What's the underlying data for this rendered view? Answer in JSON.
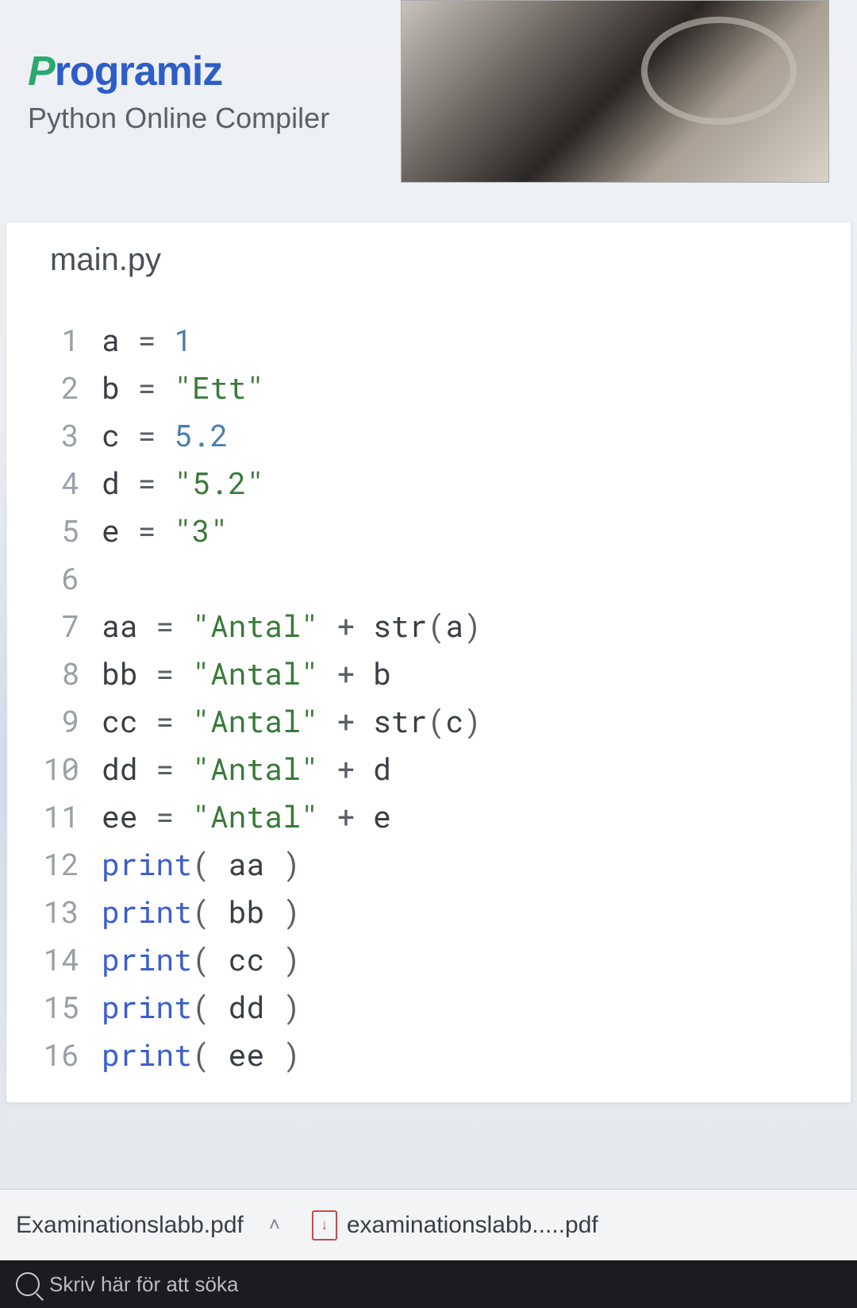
{
  "header": {
    "logo_first": "P",
    "logo_rest": "rogramiz",
    "subtitle": "Python Online Compiler"
  },
  "editor": {
    "tab_name": "main.py",
    "lines": [
      {
        "n": "1",
        "tokens": [
          [
            "var",
            "a"
          ],
          [
            "sp",
            " "
          ],
          [
            "op",
            "="
          ],
          [
            "sp",
            " "
          ],
          [
            "num",
            "1"
          ]
        ]
      },
      {
        "n": "2",
        "tokens": [
          [
            "var",
            "b"
          ],
          [
            "sp",
            " "
          ],
          [
            "op",
            "="
          ],
          [
            "sp",
            " "
          ],
          [
            "str",
            "\"Ett\""
          ]
        ]
      },
      {
        "n": "3",
        "tokens": [
          [
            "var",
            "c"
          ],
          [
            "sp",
            " "
          ],
          [
            "op",
            "="
          ],
          [
            "sp",
            " "
          ],
          [
            "num",
            "5.2"
          ]
        ]
      },
      {
        "n": "4",
        "tokens": [
          [
            "var",
            "d"
          ],
          [
            "sp",
            " "
          ],
          [
            "op",
            "="
          ],
          [
            "sp",
            " "
          ],
          [
            "str",
            "\"5.2\""
          ]
        ]
      },
      {
        "n": "5",
        "tokens": [
          [
            "var",
            "e"
          ],
          [
            "sp",
            " "
          ],
          [
            "op",
            "="
          ],
          [
            "sp",
            " "
          ],
          [
            "str",
            "\"3\""
          ]
        ]
      },
      {
        "n": "6",
        "tokens": []
      },
      {
        "n": "7",
        "tokens": [
          [
            "var",
            "aa"
          ],
          [
            "sp",
            " "
          ],
          [
            "op",
            "="
          ],
          [
            "sp",
            " "
          ],
          [
            "str",
            "\"Antal\""
          ],
          [
            "sp",
            " "
          ],
          [
            "op",
            "+"
          ],
          [
            "sp",
            " "
          ],
          [
            "fn",
            "str"
          ],
          [
            "paren",
            "("
          ],
          [
            "var",
            "a"
          ],
          [
            "paren",
            ")"
          ]
        ]
      },
      {
        "n": "8",
        "tokens": [
          [
            "var",
            "bb"
          ],
          [
            "sp",
            " "
          ],
          [
            "op",
            "="
          ],
          [
            "sp",
            " "
          ],
          [
            "str",
            "\"Antal\""
          ],
          [
            "sp",
            " "
          ],
          [
            "op",
            "+"
          ],
          [
            "sp",
            " "
          ],
          [
            "var",
            "b"
          ]
        ]
      },
      {
        "n": "9",
        "tokens": [
          [
            "var",
            "cc"
          ],
          [
            "sp",
            " "
          ],
          [
            "op",
            "="
          ],
          [
            "sp",
            " "
          ],
          [
            "str",
            "\"Antal\""
          ],
          [
            "sp",
            " "
          ],
          [
            "op",
            "+"
          ],
          [
            "sp",
            " "
          ],
          [
            "fn",
            "str"
          ],
          [
            "paren",
            "("
          ],
          [
            "var",
            "c"
          ],
          [
            "paren",
            ")"
          ]
        ]
      },
      {
        "n": "10",
        "tokens": [
          [
            "var",
            "dd"
          ],
          [
            "sp",
            " "
          ],
          [
            "op",
            "="
          ],
          [
            "sp",
            " "
          ],
          [
            "str",
            "\"Antal\""
          ],
          [
            "sp",
            " "
          ],
          [
            "op",
            "+"
          ],
          [
            "sp",
            " "
          ],
          [
            "var",
            "d"
          ]
        ]
      },
      {
        "n": "11",
        "tokens": [
          [
            "var",
            "ee"
          ],
          [
            "sp",
            " "
          ],
          [
            "op",
            "="
          ],
          [
            "sp",
            " "
          ],
          [
            "str",
            "\"Antal\""
          ],
          [
            "sp",
            " "
          ],
          [
            "op",
            "+"
          ],
          [
            "sp",
            " "
          ],
          [
            "var",
            "e"
          ]
        ]
      },
      {
        "n": "12",
        "tokens": [
          [
            "kw",
            "print"
          ],
          [
            "paren",
            "("
          ],
          [
            "sp",
            " "
          ],
          [
            "var",
            "aa"
          ],
          [
            "sp",
            " "
          ],
          [
            "paren",
            ")"
          ]
        ]
      },
      {
        "n": "13",
        "tokens": [
          [
            "kw",
            "print"
          ],
          [
            "paren",
            "("
          ],
          [
            "sp",
            " "
          ],
          [
            "var",
            "bb"
          ],
          [
            "sp",
            " "
          ],
          [
            "paren",
            ")"
          ]
        ]
      },
      {
        "n": "14",
        "tokens": [
          [
            "kw",
            "print"
          ],
          [
            "paren",
            "("
          ],
          [
            "sp",
            " "
          ],
          [
            "var",
            "cc"
          ],
          [
            "sp",
            " "
          ],
          [
            "paren",
            ")"
          ]
        ]
      },
      {
        "n": "15",
        "tokens": [
          [
            "kw",
            "print"
          ],
          [
            "paren",
            "("
          ],
          [
            "sp",
            " "
          ],
          [
            "var",
            "dd"
          ],
          [
            "sp",
            " "
          ],
          [
            "paren",
            ")"
          ]
        ]
      },
      {
        "n": "16",
        "tokens": [
          [
            "kw",
            "print"
          ],
          [
            "paren",
            "("
          ],
          [
            "sp",
            " "
          ],
          [
            "var",
            "ee"
          ],
          [
            "sp",
            " "
          ],
          [
            "paren",
            ")"
          ]
        ]
      }
    ]
  },
  "downloads": {
    "item1": "Examinationslabb.pdf",
    "item2": "examinationslabb.....pdf",
    "pdf_glyph": "⬇"
  },
  "taskbar": {
    "search_placeholder": "Skriv här för att söka"
  }
}
